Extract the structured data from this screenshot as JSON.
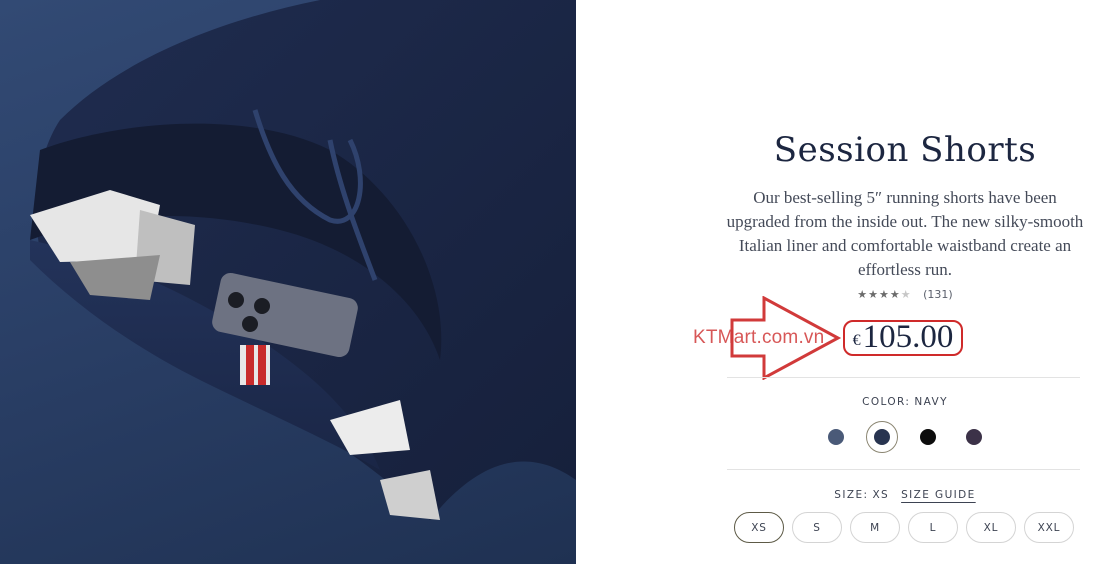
{
  "product": {
    "title": "Session Shorts",
    "description": "Our best-selling 5″ running shorts have been upgraded from the inside out. The new silky-smooth Italian liner and comfortable waistband create an effortless run.",
    "rating_stars": "★★★★",
    "rating_half": "★",
    "rating_value": 4.5,
    "review_count": "(131)",
    "price_currency": "€",
    "price_value": "105.00"
  },
  "color": {
    "label": "COLOR:",
    "selected": "NAVY",
    "swatches": [
      {
        "name": "slate",
        "hex": "#4a5a78"
      },
      {
        "name": "navy",
        "hex": "#283450",
        "selected": true
      },
      {
        "name": "black",
        "hex": "#0d0d0d"
      },
      {
        "name": "plum",
        "hex": "#3c3248"
      }
    ]
  },
  "size": {
    "label": "SIZE:",
    "selected": "XS",
    "guide_label": "SIZE GUIDE",
    "options": [
      "XS",
      "S",
      "M",
      "L",
      "XL",
      "XXL"
    ]
  },
  "annotation": {
    "watermark": "KTMart.com.vn",
    "highlight_color": "#cf2a2a"
  },
  "icons": {
    "arrow": "right-arrow-icon",
    "star": "star-icon"
  }
}
